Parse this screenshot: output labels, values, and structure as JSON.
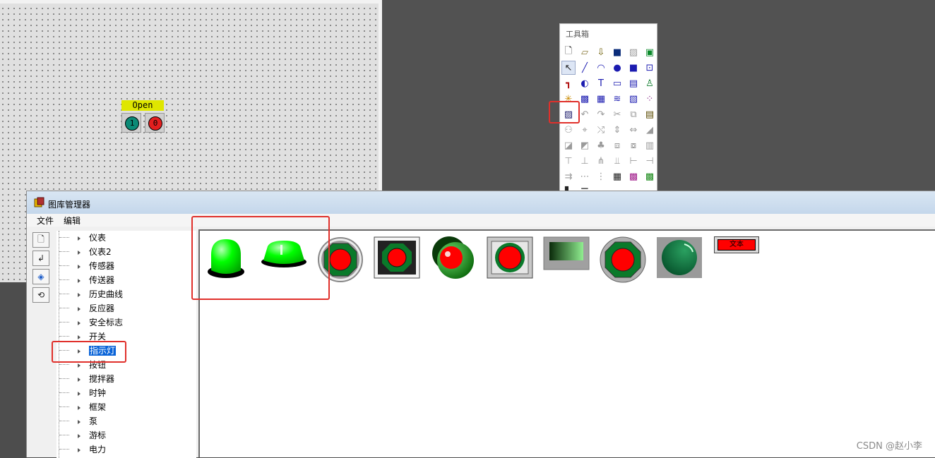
{
  "canvas": {
    "label": "Open",
    "btn_on": "1",
    "btn_off": "0"
  },
  "toolbox": {
    "title": "工具箱",
    "coords": [
      "581",
      "231",
      "64",
      "49"
    ]
  },
  "manager": {
    "title": "图库管理器",
    "menu": [
      "文件",
      "编辑"
    ],
    "tree_items": [
      "仪表",
      "仪表2",
      "传感器",
      "传送器",
      "历史曲线",
      "反应器",
      "安全标志",
      "开关",
      "指示灯",
      "按钮",
      "搅拌器",
      "时钟",
      "框架",
      "泵",
      "游标",
      "电力"
    ],
    "selected_item": "指示灯",
    "gallery_text_item": "文本"
  },
  "watermark": "CSDN @赵小李",
  "colors": {
    "lamp_green": "#00ff00",
    "lamp_red": "#ff0000",
    "highlight": "#e0302b",
    "selection": "#0a64d8"
  }
}
